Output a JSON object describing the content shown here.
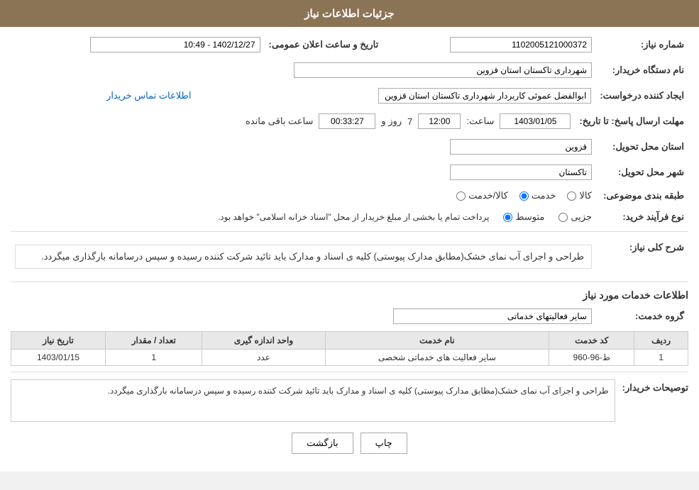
{
  "header": {
    "title": "جزئیات اطلاعات نیاز"
  },
  "fields": {
    "need_number_label": "شماره نیاز:",
    "need_number_value": "1102005121000372",
    "buyer_org_label": "نام دستگاه خریدار:",
    "buyer_org_value": "شهرداری تاکستان استان قزوین",
    "creator_label": "ایجاد کننده درخواست:",
    "creator_value": "ابوالفضل عموئی کاربردار شهرداری تاکستان استان قزوین",
    "contact_link": "اطلاعات تماس خریدار",
    "deadline_label": "مهلت ارسال پاسخ: تا تاریخ:",
    "deadline_date": "1403/01/05",
    "deadline_time_label": "ساعت:",
    "deadline_time": "12:00",
    "deadline_days_label": "روز و",
    "deadline_days": "7",
    "deadline_remaining_label": "ساعت باقی مانده",
    "deadline_remaining": "00:33:27",
    "province_label": "استان محل تحویل:",
    "province_value": "قزوین",
    "city_label": "شهر محل تحویل:",
    "city_value": "تاکستان",
    "announcement_label": "تاریخ و ساعت اعلان عمومی:",
    "announcement_value": "1402/12/27 - 10:49",
    "category_label": "طبقه بندی موضوعی:",
    "category_goods": "کالا",
    "category_service": "خدمت",
    "category_goods_service": "کالا/خدمت",
    "type_label": "نوع فرآیند خرید:",
    "type_partial": "جزیی",
    "type_medium": "متوسط",
    "type_note": "پرداخت تمام یا بخشی از مبلغ خریدار از محل \"اسناد خزانه اسلامی\" خواهد بود.",
    "description_label": "شرح کلی نیاز:",
    "description_text": "طراحی و اجرای آب نمای خشک(مطابق مدارک پیوستی) کلیه ی اسناد و مدارک باید تائید شرکت کننده رسیده و سپس درسامانه بارگذاری میگردد.",
    "services_title": "اطلاعات خدمات مورد نیاز",
    "service_group_label": "گروه خدمت:",
    "service_group_value": "سایر فعالیتهای خدماتی",
    "table_headers": [
      "ردیف",
      "کد خدمت",
      "نام خدمت",
      "واحد اندازه گیری",
      "تعداد / مقدار",
      "تاریخ نیاز"
    ],
    "table_rows": [
      {
        "row": "1",
        "code": "ط-96-960",
        "name": "سایر فعالیت های خدماتی شخصی",
        "unit": "عدد",
        "count": "1",
        "date": "1403/01/15"
      }
    ],
    "buyer_notes_label": "توصیحات خریدار:",
    "buyer_notes_text": "طراحی و اجرای آب نمای خشک(مطابق مدارک پیوستی) کلیه ی اسناد و مدارک باید تائید شرکت کننده رسیده و سپس درسامانه بارگذاری میگردد.",
    "btn_print": "چاپ",
    "btn_back": "بازگشت"
  }
}
